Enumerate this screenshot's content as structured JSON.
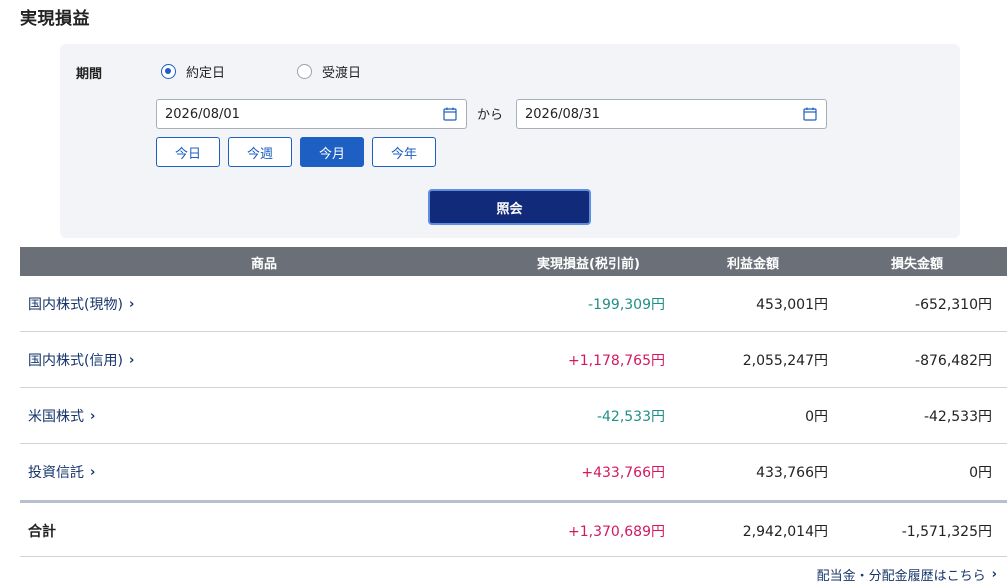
{
  "page_title": "実現損益",
  "filter": {
    "period_label": "期間",
    "radio_options": [
      {
        "label": "約定日",
        "checked": true
      },
      {
        "label": "受渡日",
        "checked": false
      }
    ],
    "start_date": "2026/08/01",
    "end_date": "2026/08/31",
    "range_separator": "から",
    "quick_buttons": [
      {
        "label": "今日",
        "active": false
      },
      {
        "label": "今週",
        "active": false
      },
      {
        "label": "今月",
        "active": true
      },
      {
        "label": "今年",
        "active": false
      }
    ],
    "submit_label": "照会"
  },
  "table": {
    "headers": [
      "商品",
      "実現損益(税引前)",
      "利益金額",
      "損失金額"
    ],
    "rows": [
      {
        "name": "国内株式(現物)",
        "realized": "-199,309円",
        "profit": "453,001円",
        "loss": "-652,310円",
        "sign": "neg"
      },
      {
        "name": "国内株式(信用)",
        "realized": "+1,178,765円",
        "profit": "2,055,247円",
        "loss": "-876,482円",
        "sign": "pos"
      },
      {
        "name": "米国株式",
        "realized": "-42,533円",
        "profit": "0円",
        "loss": "-42,533円",
        "sign": "neg"
      },
      {
        "name": "投資信託",
        "realized": "+433,766円",
        "profit": "433,766円",
        "loss": "0円",
        "sign": "pos"
      }
    ],
    "total": {
      "name": "合計",
      "realized": "+1,370,689円",
      "profit": "2,942,014円",
      "loss": "-1,571,325円",
      "sign": "pos"
    }
  },
  "footer_link": "配当金・分配金履歴はこちら",
  "chevron": "›",
  "colors": {
    "accent": "#1d5fc2",
    "submit_bg": "#112b7a",
    "header_bg": "#6b6f78",
    "gain": "#d41761",
    "loss": "#1f8f86"
  }
}
